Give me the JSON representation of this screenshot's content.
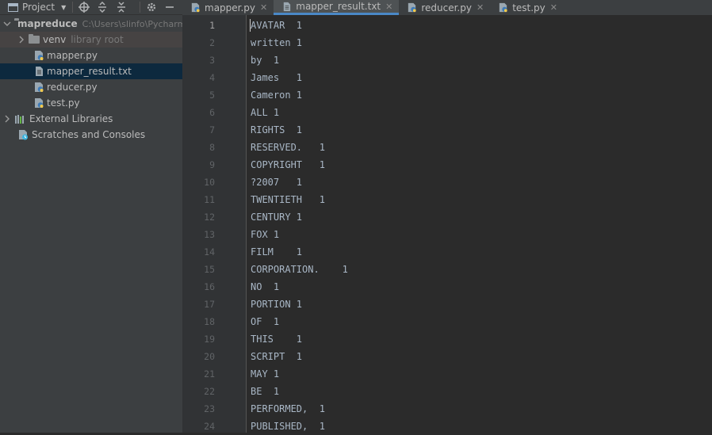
{
  "sidebar": {
    "header_title": "Project",
    "tree": [
      {
        "kind": "root",
        "label": "mapreduce",
        "path": "C:\\Users\\slinfo\\PycharmProjects\\mapreduce"
      },
      {
        "kind": "folder",
        "label": "venv",
        "note": "library root"
      },
      {
        "kind": "py",
        "label": "mapper.py"
      },
      {
        "kind": "txt",
        "label": "mapper_result.txt"
      },
      {
        "kind": "py",
        "label": "reducer.py"
      },
      {
        "kind": "py",
        "label": "test.py"
      },
      {
        "kind": "lib",
        "label": "External Libraries"
      },
      {
        "kind": "scratch",
        "label": "Scratches and Consoles"
      }
    ]
  },
  "tabs": [
    {
      "label": "mapper.py",
      "icon": "python-file-icon",
      "active": false
    },
    {
      "label": "mapper_result.txt",
      "icon": "text-file-icon",
      "active": true
    },
    {
      "label": "reducer.py",
      "icon": "python-file-icon",
      "active": false
    },
    {
      "label": "test.py",
      "icon": "python-file-icon",
      "active": false
    }
  ],
  "editor": {
    "current_line": 1,
    "lines": [
      "AVATAR  1",
      "written 1",
      "by  1",
      "James   1",
      "Cameron 1",
      "ALL 1",
      "RIGHTS  1",
      "RESERVED.   1",
      "COPYRIGHT   1",
      "?2007   1",
      "TWENTIETH   1",
      "CENTURY 1",
      "FOX 1",
      "FILM    1",
      "CORPORATION.    1",
      "NO  1",
      "PORTION 1",
      "OF  1",
      "THIS    1",
      "SCRIPT  1",
      "MAY 1",
      "BE  1",
      "PERFORMED,  1",
      "PUBLISHED,  1"
    ]
  },
  "colors": {
    "accent": "#4a88c7",
    "editor_bg": "#2b2b2b",
    "text": "#a9b7c6"
  }
}
